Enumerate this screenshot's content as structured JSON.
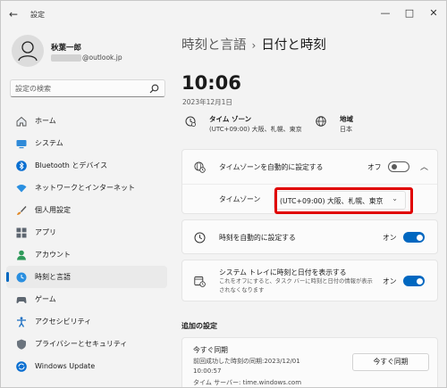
{
  "window": {
    "title": "設定",
    "controls": {
      "minimize": "—",
      "maximize": "□",
      "close": "✕"
    }
  },
  "user": {
    "name": "秋葉一郎",
    "email_suffix": "@outlook.jp"
  },
  "search": {
    "placeholder": "設定の検索"
  },
  "sidebar": {
    "items": [
      {
        "label": "ホーム",
        "icon": "home-icon",
        "active": false
      },
      {
        "label": "システム",
        "icon": "system-icon",
        "active": false
      },
      {
        "label": "Bluetooth とデバイス",
        "icon": "bluetooth-icon",
        "active": false
      },
      {
        "label": "ネットワークとインターネット",
        "icon": "network-icon",
        "active": false
      },
      {
        "label": "個人用設定",
        "icon": "brush-icon",
        "active": false
      },
      {
        "label": "アプリ",
        "icon": "apps-icon",
        "active": false
      },
      {
        "label": "アカウント",
        "icon": "account-icon",
        "active": false
      },
      {
        "label": "時刻と言語",
        "icon": "time-language-icon",
        "active": true
      },
      {
        "label": "ゲーム",
        "icon": "gaming-icon",
        "active": false
      },
      {
        "label": "アクセシビリティ",
        "icon": "accessibility-icon",
        "active": false
      },
      {
        "label": "プライバシーとセキュリティ",
        "icon": "shield-icon",
        "active": false
      },
      {
        "label": "Windows Update",
        "icon": "update-icon",
        "active": false
      }
    ]
  },
  "breadcrumb": {
    "parent": "時刻と言語",
    "separator": "›",
    "current": "日付と時刻"
  },
  "clock": {
    "time": "10:06",
    "date": "2023年12月1日"
  },
  "info": {
    "timezone": {
      "title": "タイム ゾーン",
      "value": "(UTC+09:00) 大阪、札幌、東京"
    },
    "region": {
      "title": "地域",
      "value": "日本"
    }
  },
  "settings": {
    "auto_timezone": {
      "label": "タイムゾーンを自動的に設定する",
      "state_label": "オフ",
      "on": false
    },
    "timezone_select": {
      "label": "タイムゾーン",
      "value": "(UTC+09:00) 大阪、札幌、東京"
    },
    "auto_time": {
      "label": "時刻を自動的に設定する",
      "state_label": "オン",
      "on": true
    },
    "show_tray": {
      "label": "システム トレイに時刻と日付を表示する",
      "description": "これをオフにすると、タスク バーに時刻と日付の情報が表示されなくなります",
      "state_label": "オン",
      "on": true
    }
  },
  "additional": {
    "section_title": "追加の設定",
    "sync_title": "今すぐ同期",
    "last_sync_line1": "前回成功した時刻の同期:2023/12/01",
    "last_sync_line2": "10:00:57",
    "server_line": "タイム サーバー: time.windows.com",
    "sync_button": "今すぐ同期"
  },
  "colors": {
    "accent": "#0067c0",
    "highlight": "#e00000",
    "background": "#f3f3f3"
  }
}
